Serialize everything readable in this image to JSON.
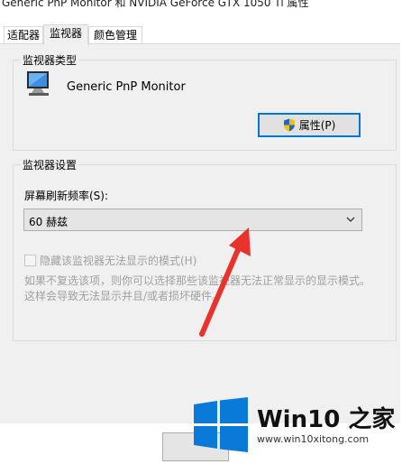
{
  "window": {
    "title": "Generic PnP Monitor 和 NVIDIA GeForce GTX 1050 Ti 属性"
  },
  "tabs": [
    {
      "label": "适配器",
      "active": false
    },
    {
      "label": "监视器",
      "active": true
    },
    {
      "label": "颜色管理",
      "active": false
    }
  ],
  "monitor_type": {
    "group_label": "监视器类型",
    "monitor_name": "Generic PnP Monitor",
    "properties_button": "属性(P)"
  },
  "monitor_settings": {
    "group_label": "监视器设置",
    "refresh_label": "屏幕刷新频率(S):",
    "refresh_value": "60 赫兹",
    "hide_modes_label": "隐藏该监视器无法显示的模式(H)",
    "hide_modes_checked": false,
    "hide_modes_enabled": false,
    "description": "如果不复选该项，则你可以选择那些该监视器无法正常显示的显示模式。这样会导致无法显示并且/或者损坏硬件。"
  },
  "watermark": {
    "brand": "Win10 之家",
    "url": "www.win10xitong.com"
  },
  "colors": {
    "accent": "#0078d7",
    "arrow": "#e8322b",
    "logo_blue": "#0a7ad8"
  }
}
